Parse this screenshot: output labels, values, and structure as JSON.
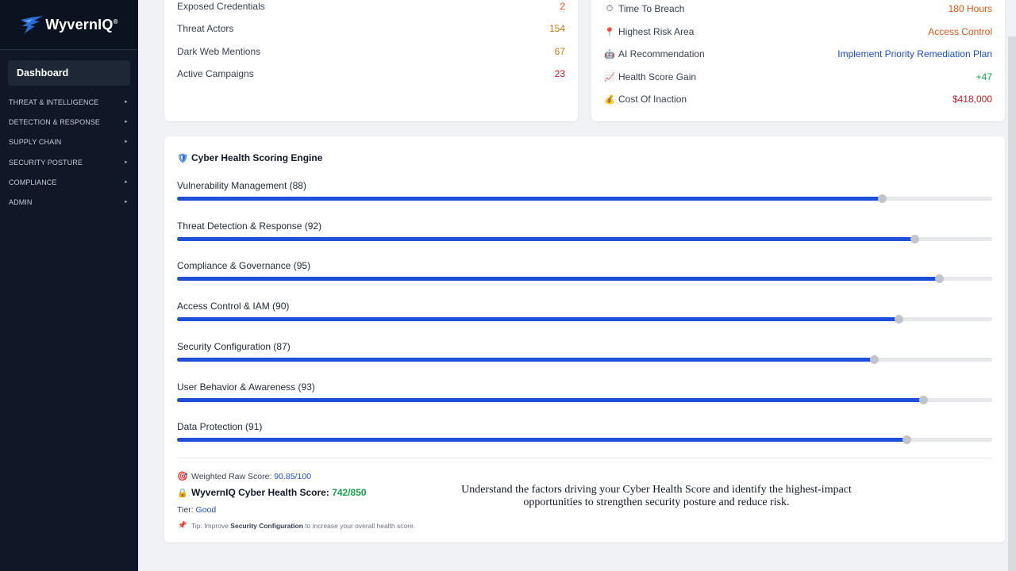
{
  "brand": {
    "name": "WyvernIQ",
    "mark": "®"
  },
  "sidebar": {
    "dashboard": "Dashboard",
    "items": [
      {
        "label": "THREAT & INTELLIGENCE"
      },
      {
        "label": "DETECTION & RESPONSE"
      },
      {
        "label": "SUPPLY CHAIN"
      },
      {
        "label": "SECURITY POSTURE"
      },
      {
        "label": "COMPLIANCE"
      },
      {
        "label": "ADMIN"
      }
    ],
    "arrow": "►"
  },
  "threat_stats": [
    {
      "label": "Exposed Credentials",
      "value": "2",
      "color": "#d9571a"
    },
    {
      "label": "Threat Actors",
      "value": "154",
      "color": "#c7780e"
    },
    {
      "label": "Dark Web Mentions",
      "value": "67",
      "color": "#c7780e"
    },
    {
      "label": "Active Campaigns",
      "value": "23",
      "color": "#c81e1e"
    }
  ],
  "insights": [
    {
      "icon": "timer-icon",
      "glyph": "⏱",
      "label": "Time To Breach",
      "value": "180 Hours",
      "color": "#d9571a"
    },
    {
      "icon": "pin-icon",
      "glyph": "📍",
      "label": "Highest Risk Area",
      "value": "Access Control",
      "color": "#d9571a"
    },
    {
      "icon": "robot-icon",
      "glyph": "🤖",
      "label": "AI Recommendation",
      "value": "Implement Priority Remediation Plan",
      "color": "#1d4ed8"
    },
    {
      "icon": "chart-up-icon",
      "glyph": "📈",
      "label": "Health Score Gain",
      "value": "+47",
      "color": "#16a34a"
    },
    {
      "icon": "money-bag-icon",
      "glyph": "💰",
      "label": "Cost Of Inaction",
      "value": "$418,000",
      "color": "#c81e1e"
    }
  ],
  "engine": {
    "title": "Cyber Health Scoring Engine",
    "metrics": [
      {
        "label": "Vulnerability Management (88)",
        "score": 88
      },
      {
        "label": "Threat Detection & Response (92)",
        "score": 92
      },
      {
        "label": "Compliance & Governance (95)",
        "score": 95
      },
      {
        "label": "Access Control & IAM (90)",
        "score": 90
      },
      {
        "label": "Security Configuration (87)",
        "score": 87
      },
      {
        "label": "User Behavior & Awareness (93)",
        "score": 93
      },
      {
        "label": "Data Protection (91)",
        "score": 91
      }
    ],
    "weighted_label": "Weighted Raw Score:",
    "weighted_value": "90.85/100",
    "health_label": "WyvernIQ Cyber Health Score:",
    "health_value": "742/850",
    "tier_label": "Tier:",
    "tier_value": "Good",
    "tip_prefix": "Tip: Improve",
    "tip_focus": "Security Configuration",
    "tip_suffix": "to increase your overall health score.",
    "tagline": "Understand the factors driving your Cyber Health Score and identify the highest-impact opportunities to strengthen security posture and reduce risk."
  },
  "colors": {
    "accent": "#1d4fd8",
    "sidebar": "#101827",
    "knob": "#c1c4c9"
  }
}
